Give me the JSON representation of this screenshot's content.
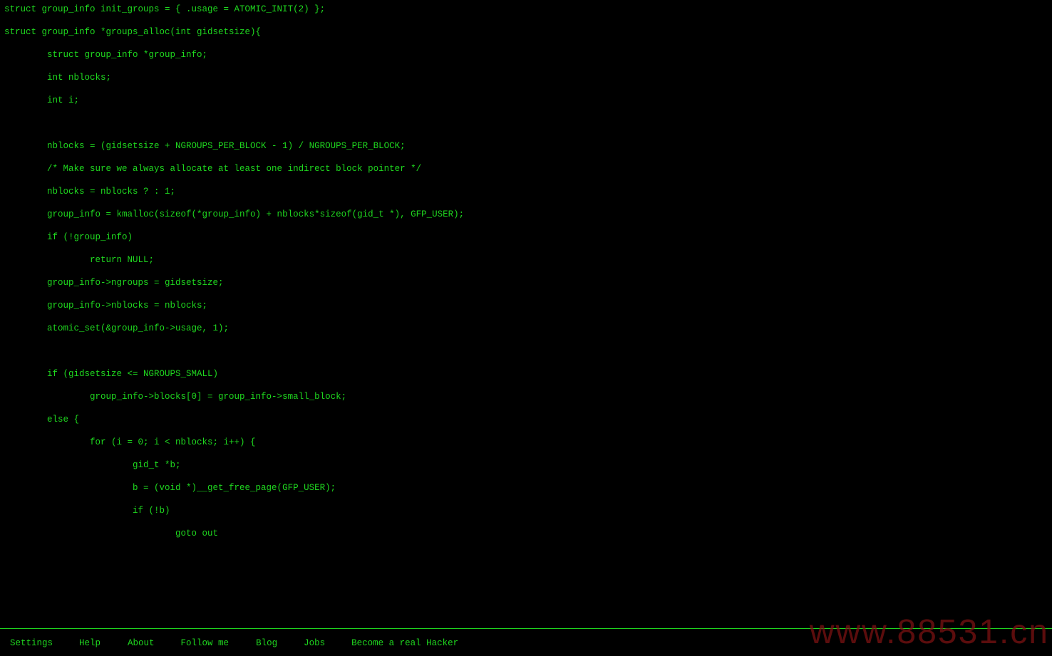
{
  "code": {
    "lines": [
      "struct group_info init_groups = { .usage = ATOMIC_INIT(2) };",
      "struct group_info *groups_alloc(int gidsetsize){",
      "        struct group_info *group_info;",
      "        int nblocks;",
      "        int i;",
      "",
      "        nblocks = (gidsetsize + NGROUPS_PER_BLOCK - 1) / NGROUPS_PER_BLOCK;",
      "        /* Make sure we always allocate at least one indirect block pointer */",
      "        nblocks = nblocks ? : 1;",
      "        group_info = kmalloc(sizeof(*group_info) + nblocks*sizeof(gid_t *), GFP_USER);",
      "        if (!group_info)",
      "                return NULL;",
      "        group_info->ngroups = gidsetsize;",
      "        group_info->nblocks = nblocks;",
      "        atomic_set(&group_info->usage, 1);",
      "",
      "        if (gidsetsize <= NGROUPS_SMALL)",
      "                group_info->blocks[0] = group_info->small_block;",
      "        else {",
      "                for (i = 0; i < nblocks; i++) {",
      "                        gid_t *b;",
      "                        b = (void *)__get_free_page(GFP_USER);",
      "                        if (!b)",
      "                                goto out"
    ]
  },
  "footer": {
    "links": [
      "Settings",
      "Help",
      "About",
      "Follow me",
      "Blog",
      "Jobs",
      "Become a real Hacker"
    ]
  },
  "watermark": "www.88531.cn",
  "colors": {
    "background": "#000000",
    "text": "#1fd81f",
    "watermark": "#7a1212"
  }
}
